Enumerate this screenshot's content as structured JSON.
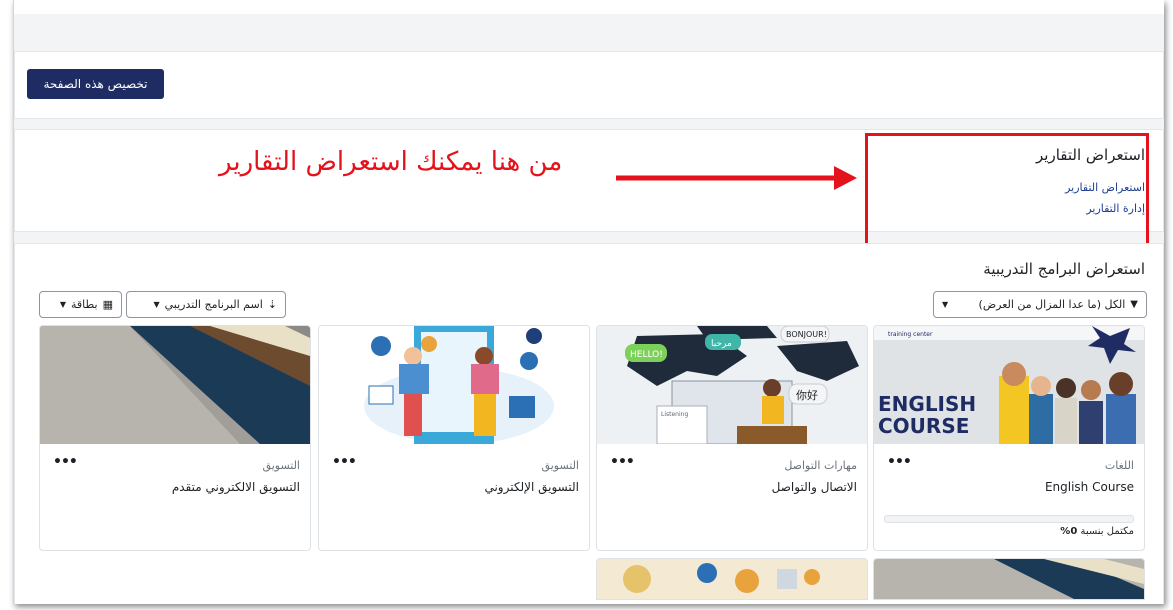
{
  "page": {
    "customize_button": "تخصيص هذه الصفحة"
  },
  "reports_block": {
    "title": "استعراض التقارير",
    "links": [
      "استعراض التقارير",
      "إدارة التقارير"
    ]
  },
  "annotation": {
    "text": "من هنا يمكنك استعراض التقارير",
    "color": "#e4121b"
  },
  "courses_block": {
    "title": "استعراض البرامج التدريبية",
    "filter_dropdown": "الكل (ما عدا المزال من العرض)",
    "sort_dropdown": "اسم البرنامج التدريبي",
    "view_dropdown": "بطاقة",
    "more_menu": "•••",
    "cards": [
      {
        "category": "اللغات",
        "name": "English Course",
        "image_text": [
          "ENGLISH",
          "COURSE"
        ],
        "image_label": "training center",
        "progress_label": "مكتمل بنسبة ",
        "progress_value": "0%",
        "progress_fraction": 0
      },
      {
        "category": "مهارات التواصل",
        "name": "الاتصال والتواصل",
        "bubbles": [
          "HELLO!",
          "مرحبا",
          "BONJOUR!",
          "你好",
          "Listening"
        ]
      },
      {
        "category": "التسويق",
        "name": "التسويق الإلكتروني"
      },
      {
        "category": "التسويق",
        "name": "التسويق الالكتروني متقدم"
      }
    ]
  },
  "colors": {
    "primary": "#1e2c63",
    "link": "#1e3f8f",
    "annotation_red": "#e4121b"
  }
}
